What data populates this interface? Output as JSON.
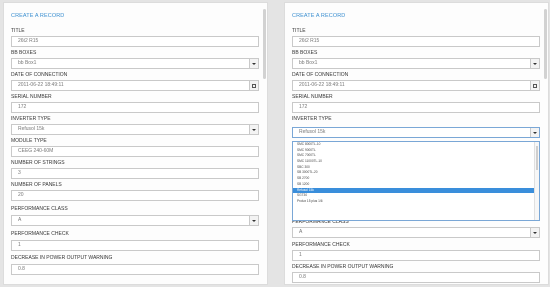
{
  "form_title": "CREATE A RECORD",
  "fields": {
    "title": {
      "label": "TITLE",
      "value": "26t2 R15"
    },
    "bb_boxes": {
      "label": "BB BOXES",
      "value": "bb Box1"
    },
    "date_of_connection": {
      "label": "DATE OF CONNECTION",
      "value": "2011-06-22  18:49:11"
    },
    "serial_number": {
      "label": "SERIAL NUMBER",
      "value": "172"
    },
    "inverter_type": {
      "label": "INVERTER TYPE",
      "value": "Refusol 15k"
    },
    "module_type": {
      "label": "MODULE TYPE",
      "value": "CEEG 240-60M"
    },
    "number_of_strings": {
      "label": "NUMBER OF STRINGS",
      "value": "3"
    },
    "number_of_panels": {
      "label": "NUMBER OF PANELS",
      "value": "20"
    },
    "performance_class": {
      "label": "PERFORMANCE CLASS",
      "value": "A"
    },
    "performance_check": {
      "label": "PERFORMANCE CHECK",
      "value": "1"
    },
    "decrease_warning": {
      "label": "DECREASE IN POWER OUTPUT WARNING",
      "value": "0.8"
    }
  },
  "inverter_options": [
    "SMC 8000TL-10",
    "SMC 9000TL",
    "SMC 7000TL",
    "SMC 11000TL-10",
    "SBC 300",
    "SB 3000TL-20",
    "SB 2700",
    "SB 1200",
    "Refusol 15k",
    "SGT30",
    "Prolux 15 plus 1/6"
  ],
  "inverter_selected_index": 8,
  "icons": {
    "dropdown": "chevron-down-icon",
    "calendar": "calendar-icon"
  },
  "colors": {
    "accent": "#3b8fd0",
    "selected_option": "#3a8edb",
    "background": "#e4e4e4"
  }
}
